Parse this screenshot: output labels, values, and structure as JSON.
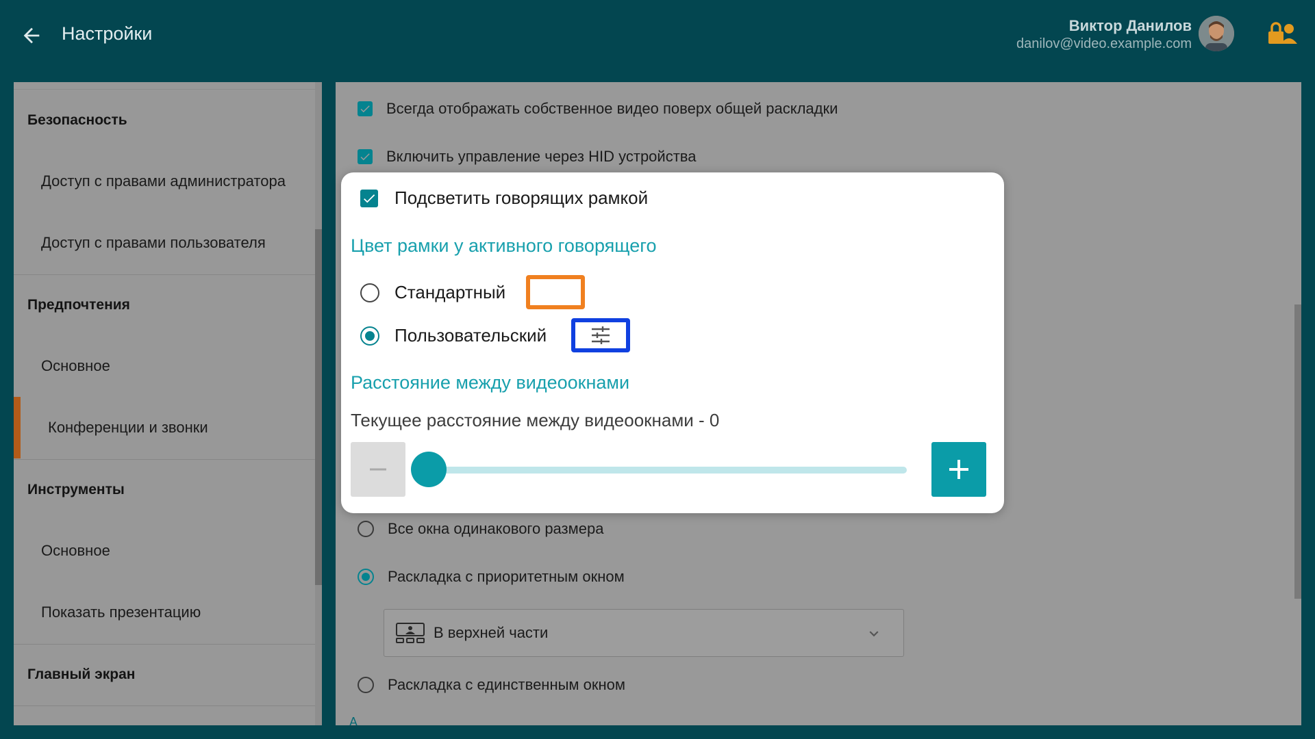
{
  "header": {
    "title": "Настройки",
    "user_name": "Виктор Данилов",
    "user_email": "danilov@video.example.com"
  },
  "sidebar": {
    "sections": [
      {
        "title": "Безопасность",
        "items": [
          "Доступ с правами администратора",
          "Доступ с правами пользователя"
        ]
      },
      {
        "title": "Предпочтения",
        "items": [
          "Основное",
          "Конференции и звонки"
        ]
      },
      {
        "title": "Инструменты",
        "items": [
          "Основное",
          "Показать презентацию"
        ]
      },
      {
        "title": "Главный экран",
        "items": []
      }
    ],
    "active_item": "Конференции и звонки"
  },
  "main": {
    "options": {
      "own_video_on_top": {
        "label": "Всегда отображать собственное видео поверх общей раскладки",
        "checked": true
      },
      "hid_control": {
        "label": "Включить управление через HID устройства",
        "checked": true
      }
    },
    "layout_options": [
      {
        "label": "Все окна одинакового размера",
        "selected": false
      },
      {
        "label": "Раскладка с приоритетным окном",
        "selected": true
      },
      {
        "label": "Раскладка с единственным окном",
        "selected": false
      }
    ],
    "priority_position": {
      "value": "В верхней части"
    },
    "partial_text": "А"
  },
  "popup": {
    "highlight_speakers": {
      "label": "Подсветить говорящих рамкой",
      "checked": true
    },
    "frame_color_heading": "Цвет рамки у активного говорящего",
    "color_options": [
      {
        "label": "Стандартный",
        "selected": false,
        "color": "#f08020"
      },
      {
        "label": "Пользовательский",
        "selected": true,
        "color": "#1040e0"
      }
    ],
    "spacing_heading": "Расстояние между видеоокнами",
    "current_spacing_label": "Текущее расстояние между видеоокнами - 0",
    "spacing_value": 0
  },
  "colors": {
    "header_bg": "#034650",
    "accent": "#0b9ca8",
    "active_marker": "#b35b19"
  }
}
